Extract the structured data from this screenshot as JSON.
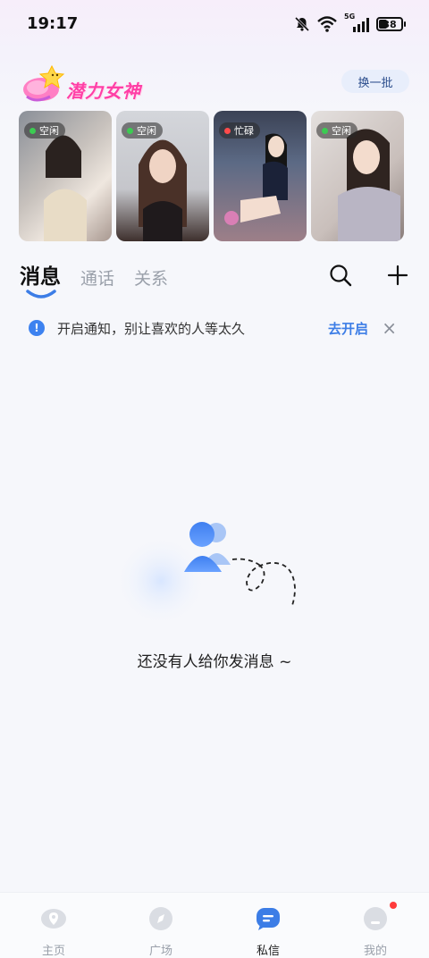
{
  "status_bar": {
    "time": "19:17",
    "network": "5G",
    "battery": "38"
  },
  "banner": {
    "title": "潜力女神",
    "refresh_label": "换一批"
  },
  "cards": [
    {
      "status": "空闲",
      "status_color": "#3ccb52",
      "bg": [
        "#6b6f78",
        "#d7d2d0"
      ]
    },
    {
      "status": "空闲",
      "status_color": "#3ccb52",
      "bg": [
        "#c9ccd2",
        "#4a3a36"
      ]
    },
    {
      "status": "忙碌",
      "status_color": "#ff4b4b",
      "bg": [
        "#2c3345",
        "#8a6f78"
      ]
    },
    {
      "status": "空闲",
      "status_color": "#3ccb52",
      "bg": [
        "#dcd8d6",
        "#a89f9c"
      ]
    }
  ],
  "tabs": [
    {
      "label": "消息",
      "active": true
    },
    {
      "label": "通话",
      "active": false
    },
    {
      "label": "关系",
      "active": false
    }
  ],
  "notification": {
    "text": "开启通知，别让喜欢的人等太久",
    "action": "去开启",
    "close_glyph": "×"
  },
  "empty_state": {
    "text": "还没有人给你发消息 ~"
  },
  "bottom_nav": [
    {
      "label": "主页",
      "active": false,
      "icon": "home-icon"
    },
    {
      "label": "广场",
      "active": false,
      "icon": "compass-icon"
    },
    {
      "label": "私信",
      "active": true,
      "icon": "chat-icon"
    },
    {
      "label": "我的",
      "active": false,
      "icon": "profile-icon",
      "badge": true
    }
  ],
  "colors": {
    "accent": "#3c7de6",
    "banner_pink": "#ff3fa6",
    "badge_red": "#ff3b3b"
  }
}
